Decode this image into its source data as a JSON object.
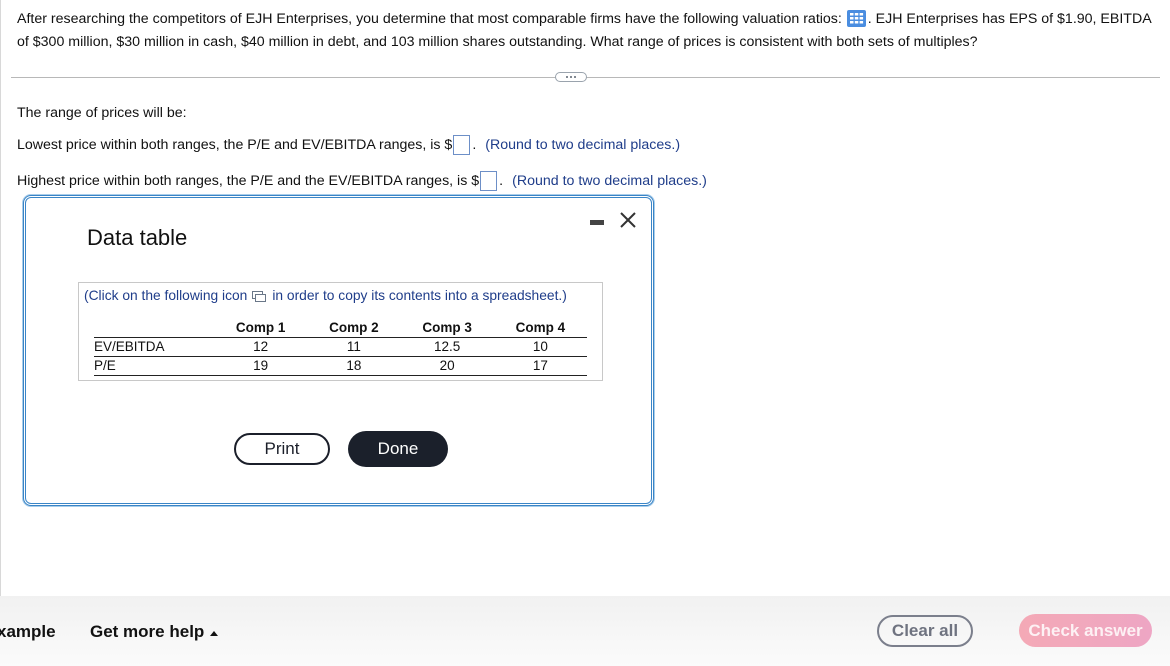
{
  "question": {
    "text_before_icon": "After researching the competitors of EJH Enterprises, you determine that most comparable firms have the following valuation ratios:",
    "icon": "table-grid-icon",
    "text_after_icon": ". EJH Enterprises has EPS of $1.90, EBITDA of $300 million, $30 million in cash, $40 million in debt, and 103 million shares outstanding. What range of prices is consistent with both sets of multiples?"
  },
  "answer": {
    "intro": "The range of prices will be:",
    "lowest": {
      "prefix": "Lowest price within both ranges, the P/E and  EV/EBITDA ranges, is $",
      "value": "",
      "suffix": ".",
      "hint": "(Round to two decimal places.)"
    },
    "highest": {
      "prefix": "Highest price within both ranges, the P/E and the EV/EBITDA ranges, is $",
      "value": "",
      "suffix": ".",
      "hint": "(Round to two decimal places.)"
    }
  },
  "dialog": {
    "title": "Data table",
    "copy_note_before": "(Click on the following icon",
    "copy_note_after": "in order to copy its contents into a spreadsheet.)",
    "table": {
      "headers": [
        "",
        "Comp 1",
        "Comp 2",
        "Comp 3",
        "Comp 4"
      ],
      "rows": [
        {
          "label": "EV/EBITDA",
          "values": [
            "12",
            "11",
            "12.5",
            "10"
          ]
        },
        {
          "label": "P/E",
          "values": [
            "19",
            "18",
            "20",
            "17"
          ]
        }
      ]
    },
    "print_label": "Print",
    "done_label": "Done"
  },
  "footer": {
    "example_label": "xample",
    "help_label": "Get more help",
    "clear_label": "Clear all",
    "check_label": "Check answer"
  }
}
